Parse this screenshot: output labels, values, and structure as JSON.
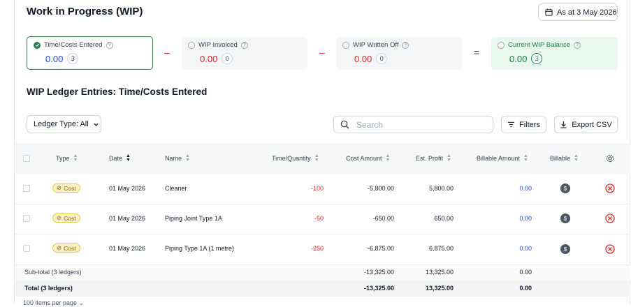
{
  "header": {
    "title": "Work in Progress (WIP)",
    "as_at_label": "As at 3 May 2026"
  },
  "summary": {
    "cards": [
      {
        "label": "Time/Costs Entered",
        "value": "0.00",
        "count": "3",
        "selected": true
      },
      {
        "label": "WIP Invoiced",
        "value": "0.00",
        "count": "0",
        "selected": false
      },
      {
        "label": "WIP Written Off",
        "value": "0.00",
        "count": "0",
        "selected": false
      },
      {
        "label": "Current WIP Balance",
        "value": "0.00",
        "count": "3",
        "selected": false
      }
    ],
    "operators": [
      "–",
      "–",
      "="
    ]
  },
  "ledger": {
    "title": "WIP Ledger Entries: Time/Costs Entered",
    "type_filter": "Ledger Type: All",
    "search_placeholder": "Search",
    "filters_label": "Filters",
    "export_label": "Export CSV",
    "columns": [
      "Type",
      "Date",
      "Name",
      "Time/Quantity",
      "Cost Amount",
      "Est. Profit",
      "Billable Amount",
      "Billable"
    ],
    "rows": [
      {
        "type": "Cost",
        "date": "01 May 2026",
        "name": "Cleaner",
        "quantity": "-100",
        "cost": "-5,800.00",
        "profit": "5,800.00",
        "billable_amount": "0.00"
      },
      {
        "type": "Cost",
        "date": "01 May 2026",
        "name": "Piping Joint Type 1A",
        "quantity": "-50",
        "cost": "-650.00",
        "profit": "650.00",
        "billable_amount": "0.00"
      },
      {
        "type": "Cost",
        "date": "01 May 2026",
        "name": "Piping Type 1A (1 metre)",
        "quantity": "-250",
        "cost": "-6,875.00",
        "profit": "6,875.00",
        "billable_amount": "0.00"
      }
    ],
    "subtotal": {
      "label": "Sub-total (3 ledgers)",
      "cost": "-13,325.00",
      "profit": "13,325.00",
      "billable_amount": "0.00"
    },
    "total": {
      "label": "Total (3 ledgers)",
      "cost": "-13,325.00",
      "profit": "13,325.00",
      "billable_amount": "0.00"
    },
    "footer_text": "100 items per page ⌄"
  },
  "colors": {
    "accent_green": "#2e7d4f",
    "negative_red": "#dc2626",
    "link_blue": "#1d4ed8",
    "tag_yellow": "#fdf2c4"
  }
}
